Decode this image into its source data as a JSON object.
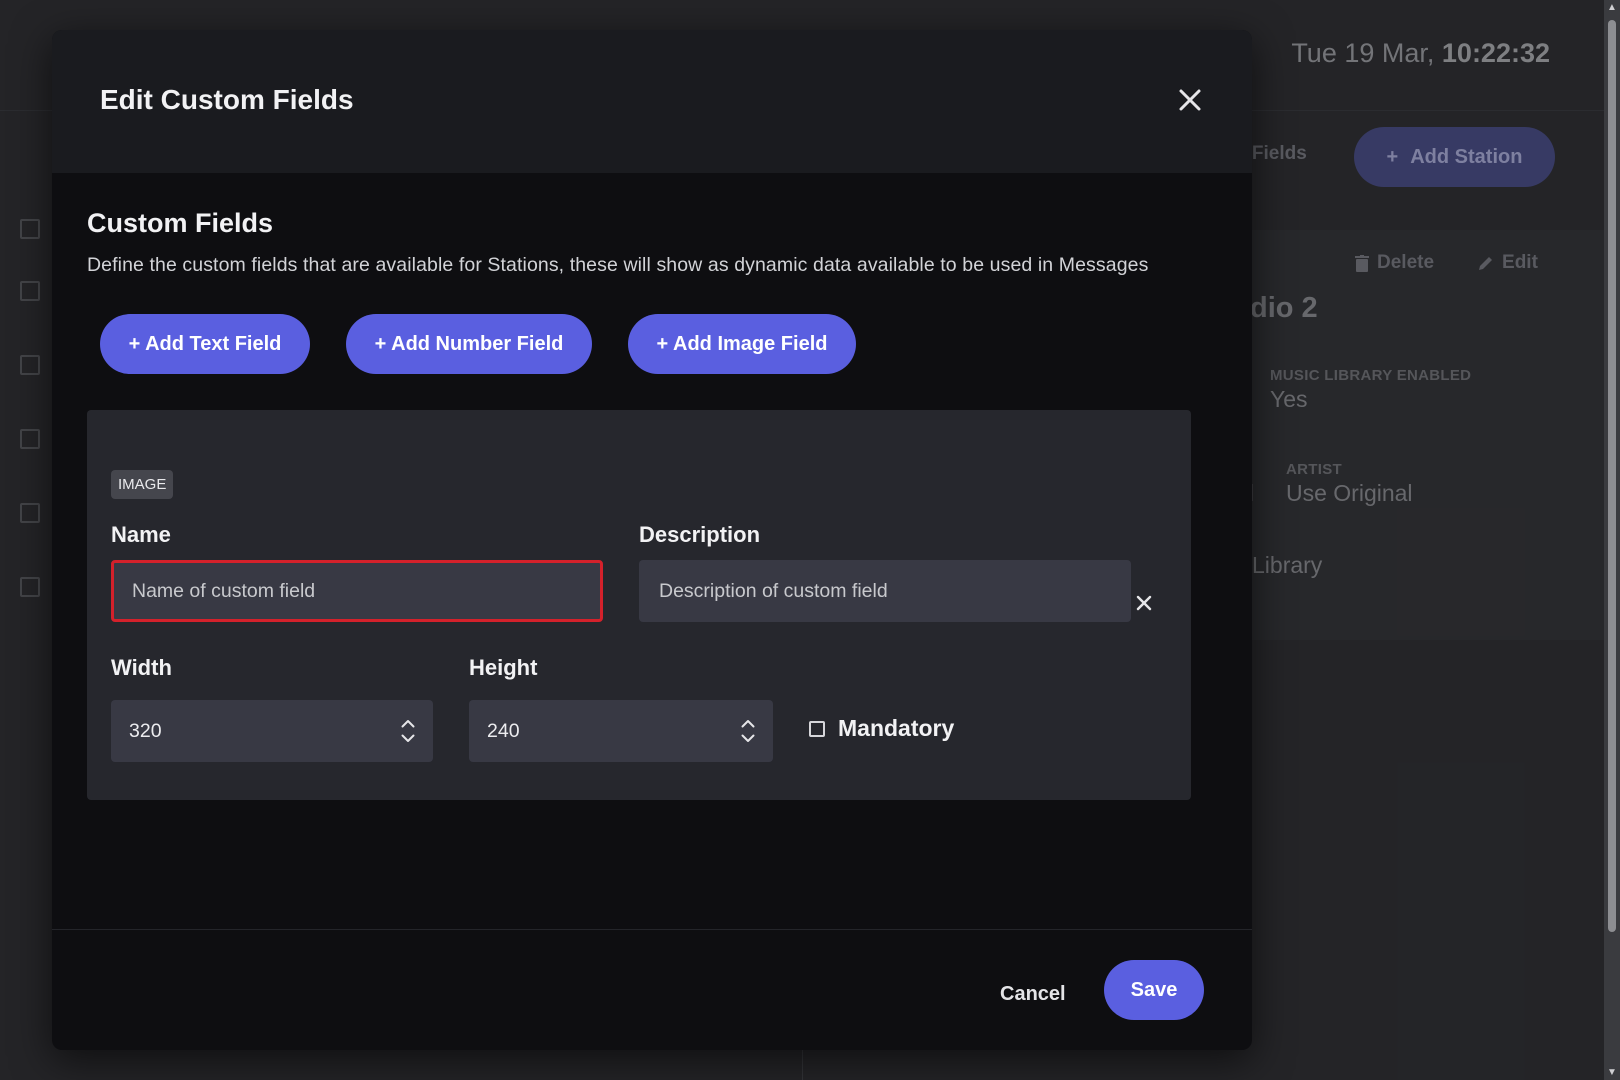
{
  "background": {
    "datetime_date": "Tue 19 Mar,",
    "datetime_time": "10:22:32",
    "custom_fields_link": "n Fields",
    "add_station": "Add Station",
    "delete_label": "Delete",
    "edit_label": "Edit",
    "station_title": "dio 2",
    "music_library_label": "MUSIC LIBRARY ENABLED",
    "music_library_value": "Yes",
    "artist_label": "ARTIST",
    "artist_value": "Use Original",
    "artist_left_fragment": "al",
    "library_fragment": "Library"
  },
  "modal": {
    "title": "Edit Custom Fields",
    "section_title": "Custom Fields",
    "section_desc": "Define the custom fields that are available for Stations, these will show as dynamic data available to be used in Messages",
    "buttons": {
      "add_text": "+ Add Text Field",
      "add_number": "+ Add Number Field",
      "add_image": "+ Add Image Field"
    },
    "field": {
      "type_badge": "IMAGE",
      "name_label": "Name",
      "name_value": "",
      "name_placeholder": "Name of custom field",
      "description_label": "Description",
      "description_value": "",
      "description_placeholder": "Description of custom field",
      "width_label": "Width",
      "width_value": "320",
      "height_label": "Height",
      "height_value": "240",
      "mandatory_label": "Mandatory",
      "mandatory_checked": false
    },
    "footer": {
      "cancel": "Cancel",
      "save": "Save"
    }
  },
  "colors": {
    "accent": "#5a5fe0",
    "error_border": "#d4212b",
    "modal_bg": "#0e0e11",
    "card_bg": "#26272d"
  },
  "icons": [
    "close-icon",
    "remove-field-icon",
    "chevron-up-icon",
    "chevron-down-icon",
    "plus-icon",
    "trash-icon",
    "pencil-icon"
  ]
}
